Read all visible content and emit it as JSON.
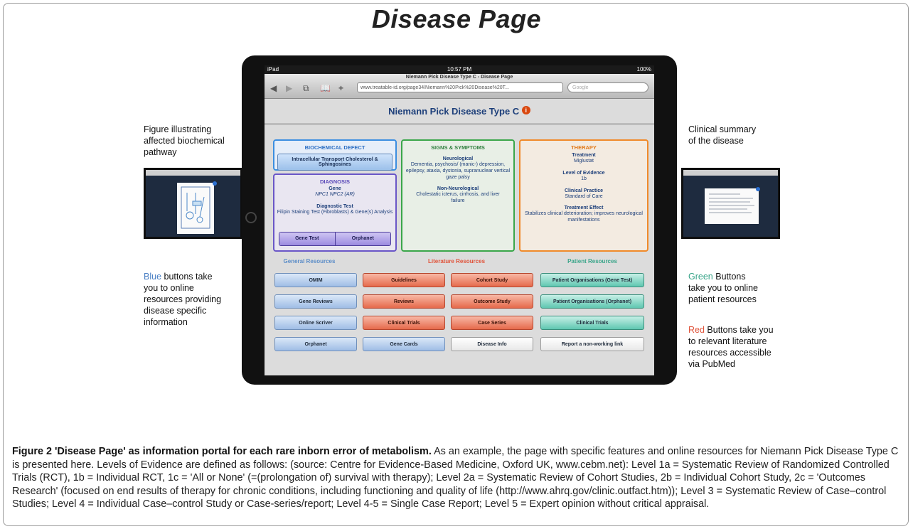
{
  "figure_title": "Disease Page",
  "left_annotation_top": [
    "Figure illustrating",
    "affected biochemical",
    "pathway"
  ],
  "right_annotation_top": [
    "Clinical summary",
    "of the disease"
  ],
  "left_annotation_bottom": {
    "highlight": "Blue",
    "rest": [
      "buttons take",
      "you to online",
      "resources providing",
      "disease specific",
      "information"
    ]
  },
  "right_annotation_green": {
    "highlight": "Green",
    "rest": [
      "Buttons",
      "take you to online",
      "patient resources"
    ]
  },
  "right_annotation_red": {
    "highlight": "Red",
    "rest": [
      "Buttons take you",
      "to relevant literature",
      "resources accessible",
      "via PubMed"
    ]
  },
  "colors": {
    "blue": "#4a7fc4",
    "green": "#3aa58a",
    "red": "#e0533a"
  },
  "ipad": {
    "status": {
      "carrier": "iPad",
      "time": "10:57 PM",
      "battery": "100%"
    },
    "page_title": "Niemann Pick Disease Type C - Disease Page",
    "url": "www.treatable-id.org/page34/Niemann%20Pick%20Disease%20T...",
    "search_placeholder": "Google",
    "disease_name": "Niemann Pick Disease Type C",
    "biochemical_defect": {
      "heading": "BIOCHEMICAL DEFECT",
      "button": "Intracellular Transport Cholesterol & Sphingosines"
    },
    "diagnosis": {
      "heading": "DIAGNOSIS",
      "gene_label": "Gene",
      "gene_value": "NPC1 NPC2 (AR)",
      "test_label": "Diagnostic Test",
      "test_value": "Filipin Staining Test (Fibroblasts) & Gene(s) Analysis",
      "buttons": [
        "Gene Test",
        "Orphanet"
      ]
    },
    "signs": {
      "heading": "SIGNS & SYMPTOMS",
      "neuro_label": "Neurological",
      "neuro_value": "Dementia, psychosis/ (manic-) depression, epilepsy, ataxia, dystonia, supranuclear vertical gaze palsy",
      "nonneuro_label": "Non-Neurological",
      "nonneuro_value": "Cholestatic icterus, cirrhosis, and liver failure"
    },
    "therapy": {
      "heading": "THERAPY",
      "treatment_label": "Treatment",
      "treatment_value": "Miglustat",
      "loe_label": "Level of Evidence",
      "loe_value": "1b",
      "practice_label": "Clinical Practice",
      "practice_value": "Standard of Care",
      "effect_label": "Treatment Effect",
      "effect_value": "Stabilizes clinical deterioration; improves neurological manifestations"
    },
    "resources": {
      "general_heading": "General Resources",
      "literature_heading": "Literature Resources",
      "patient_heading": "Patient Resources",
      "general": [
        "OMIM",
        "Gene Reviews",
        "Online Scriver",
        "Orphanet"
      ],
      "literature_col1": [
        "Guidelines",
        "Reviews",
        "Clinical Trials",
        "Gene Cards"
      ],
      "literature_col2": [
        "Cohort Study",
        "Outcome Study",
        "Case Series",
        "Disease Info"
      ],
      "patient": [
        "Patient Organisations (Gene Test)",
        "Patient Organisations (Orphanet)",
        "Clinical Trials",
        "Report a non-working link"
      ]
    }
  },
  "caption": {
    "label": "Figure 2",
    "title": "'Disease Page' as information portal for each rare inborn error of metabolism.",
    "body": "As an example, the page with specific features and online resources for Niemann Pick Disease Type C is presented here. Levels of Evidence are defined as follows: (source: Centre for Evidence-Based Medicine, Oxford UK, www.cebm.net): Level 1a = Systematic Review of Randomized Controlled Trials (RCT), 1b = Individual RCT, 1c = 'All or None' (=(prolongation of) survival with therapy); Level 2a = Systematic Review of Cohort Studies, 2b = Individual Cohort Study, 2c = 'Outcomes Research' (focused on end results of therapy for chronic conditions, including functioning and quality of life (http://www.ahrq.gov/clinic.outfact.htm)); Level 3 = Systematic Review of Case–control Studies; Level 4 = Individual Case–control Study or Case-series/report; Level 4-5 = Single Case Report; Level 5 = Expert opinion without critical appraisal."
  }
}
